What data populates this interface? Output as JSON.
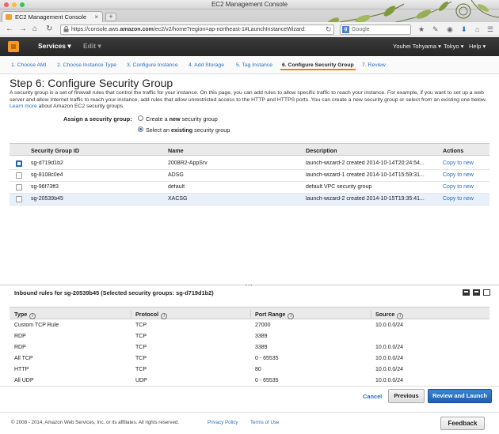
{
  "window": {
    "title": "EC2 Management Console"
  },
  "tab": {
    "title": "EC2 Management Console",
    "close": "×",
    "new_tab": "+"
  },
  "address": {
    "url_prefix": "https://console.aws.",
    "url_host": "amazon.com",
    "url_rest": "/ec2/v2/home?region=ap-northeast-1#LaunchInstanceWizard:",
    "search_placeholder": "Google",
    "search_engine": "g"
  },
  "aws": {
    "services_label": "Services",
    "edit_label": "Edit",
    "user": "Youhei Tohyama",
    "region": "Tokyo",
    "help": "Help"
  },
  "wizard": {
    "steps": [
      "1. Choose AMI",
      "2. Choose Instance Type",
      "3. Configure Instance",
      "4. Add Storage",
      "5. Tag Instance",
      "6. Configure Security Group",
      "7. Review"
    ],
    "active_step": 5
  },
  "page": {
    "title": "Step 6: Configure Security Group",
    "description": "A security group is a set of firewall rules that control the traffic for your instance. On this page, you can add rules to allow specific traffic to reach your instance. For example, if you want to set up a web server and allow Internet traffic to reach your instance, add rules that allow unrestricted access to the HTTP and HTTPS ports. You can create a new security group or select from an existing one below.",
    "learn_more": "Learn more",
    "learn_more_suffix": "about Amazon EC2 security groups.",
    "assign_label": "Assign a security group:",
    "option_new_pre": "Create a ",
    "option_new_bold": "new",
    "option_new_post": " security group",
    "option_existing_pre": "Select an ",
    "option_existing_bold": "existing",
    "option_existing_post": " security group"
  },
  "sg_table": {
    "headers": [
      "Security Group ID",
      "Name",
      "Description",
      "Actions"
    ],
    "rows": [
      {
        "id": "sg-d719d1b2",
        "name": "2008R2-AppSrv",
        "description": "launch-wizard-2 created 2014-10-14T20:24:54...",
        "action": "Copy to new",
        "checked": true
      },
      {
        "id": "sg-8108c0e4",
        "name": "ADSG",
        "description": "launch-wizard-1 created 2014-10-14T15:59:31...",
        "action": "Copy to new",
        "checked": false
      },
      {
        "id": "sg-96f73ff3",
        "name": "default",
        "description": "default VPC security group",
        "action": "Copy to new",
        "checked": false
      },
      {
        "id": "sg-20539b45",
        "name": "XACSG",
        "description": "launch-wizard-2 created 2014-10-15T19:35:41...",
        "action": "Copy to new",
        "checked": false
      }
    ]
  },
  "inbound": {
    "title": "Inbound rules for sg-20539b45 (Selected security groups: sg-d719d1b2)",
    "headers": [
      "Type",
      "Protocol",
      "Port Range",
      "Source"
    ],
    "rows": [
      {
        "type": "Custom TCP Rule",
        "protocol": "TCP",
        "port": "27000",
        "source": "10.0.0.0/24"
      },
      {
        "type": "RDP",
        "protocol": "TCP",
        "port": "3389",
        "source": ""
      },
      {
        "type": "RDP",
        "protocol": "TCP",
        "port": "3389",
        "source": "10.0.0.0/24"
      },
      {
        "type": "All TCP",
        "protocol": "TCP",
        "port": "0 - 65535",
        "source": "10.0.0.0/24"
      },
      {
        "type": "HTTP",
        "protocol": "TCP",
        "port": "80",
        "source": "10.0.0.0/24"
      },
      {
        "type": "All UDP",
        "protocol": "UDP",
        "port": "0 - 65535",
        "source": "10.0.0.0/24"
      }
    ]
  },
  "buttons": {
    "cancel": "Cancel",
    "previous": "Previous",
    "review": "Review and Launch"
  },
  "footer": {
    "copyright": "© 2008 - 2014, Amazon Web Services, Inc. or its affiliates. All rights reserved.",
    "privacy": "Privacy Policy",
    "terms": "Terms of Use",
    "feedback": "Feedback"
  },
  "colors": {
    "accent": "#2a6ebb",
    "aws_orange": "#f59a23",
    "header": "#262626"
  }
}
